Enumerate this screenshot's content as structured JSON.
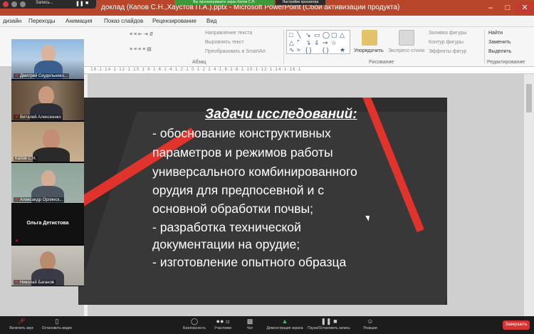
{
  "zoom": {
    "recording_label": "Запись...",
    "share_banner": "Вы просматриваете экран Капов С.Н.",
    "view_options": "Настройки просмотра",
    "colors": {
      "share_green": "#3c9a3c",
      "end_red": "#d63434",
      "toolbar_bg": "#1c1c1c"
    },
    "toolbar": [
      {
        "label": "Включить звук",
        "icon": "mic-muted-icon"
      },
      {
        "label": "Остановить видео",
        "icon": "video-icon"
      },
      {
        "label": "Безопасность",
        "icon": "shield-icon"
      },
      {
        "label": "Участники",
        "icon": "participants-icon",
        "count": "22"
      },
      {
        "label": "Чат",
        "icon": "chat-icon"
      },
      {
        "label": "Демонстрация экрана",
        "icon": "share-screen-icon"
      },
      {
        "label": "Пауза/Остановить запись",
        "icon": "record-pause-icon"
      },
      {
        "label": "Реакции",
        "icon": "reactions-icon"
      }
    ],
    "end_label": "Завершить",
    "participants": [
      {
        "name": "Дмитрий Скудельнико..."
      },
      {
        "name": "Виталий Алексеенко"
      },
      {
        "name": "Капов С.Н."
      },
      {
        "name": "Александр Орлянск..."
      },
      {
        "name": "Ольга Детистова"
      },
      {
        "name": "Николай Баганов"
      }
    ]
  },
  "ppt": {
    "window_title": "доклад (Капов С.Н.,Хаустов П.А.).pptx - Microsoft PowerPoint (Сбой активизации продукта)",
    "accent": "#b8462a",
    "tabs": [
      "дизайн",
      "Переходы",
      "Анимация",
      "Показ слайдов",
      "Рецензирование",
      "Вид"
    ],
    "ribbon": {
      "text_direction": "Направление текста",
      "align_text": "Выровнять текст",
      "convert_smartart": "Преобразовать в SmartArt",
      "paragraph_group": "Абзац",
      "arrange": "Упорядочить",
      "quick_styles": "Экспресс-стили",
      "shape_fill": "Заливка фигуры",
      "shape_outline": "Контур фигуры",
      "shape_effects": "Эффекты фигур",
      "drawing_group": "Рисование",
      "find": "Найти",
      "replace": "Заменить",
      "select": "Выделить",
      "editing_group": "Редактирование"
    },
    "ruler_text": "·16·1·14·1·12·1·10·1·8·1·6·1·4·1·2·1·0·1·2·1·4·1·6·1·8·1·10·1·12·1·14·1·16·1"
  },
  "slide": {
    "title": "Задачи исследований:",
    "lines": [
      "- обоснование конструктивных",
      "параметров и режимов работы",
      "универсального комбинированного",
      "орудия для предпосевной и с",
      "основной обработки почвы;",
      " - разработка технической",
      "документации на орудие;",
      "- изготовление опытного образца"
    ],
    "colors": {
      "background": "#2e2e2e",
      "stripe": "#e0332c",
      "text": "#ffffff"
    }
  }
}
